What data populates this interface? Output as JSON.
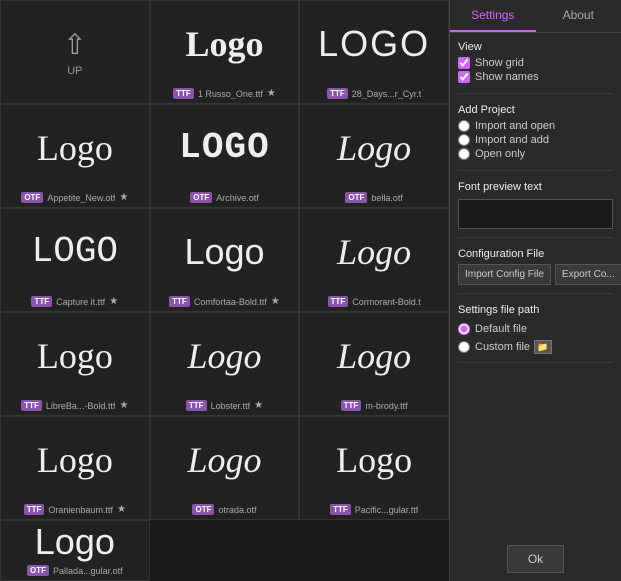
{
  "tabs": {
    "settings": "Settings",
    "about": "About"
  },
  "view": {
    "title": "View",
    "show_grid": "Show grid",
    "show_names": "Show names",
    "show_grid_checked": true,
    "show_names_checked": true
  },
  "add_project": {
    "title": "Add Project",
    "import_and_open": "Import and open",
    "import_and_add": "Import and add",
    "open_only": "Open only"
  },
  "font_preview": {
    "title": "Font preview text",
    "placeholder": ""
  },
  "config_file": {
    "title": "Configuration File",
    "import_btn": "Import Config File",
    "export_btn": "Export Co..."
  },
  "settings_file_path": {
    "title": "Settings file path",
    "default_file": "Default file",
    "custom_file": "Custom file"
  },
  "ok_btn": "Ok",
  "fonts": [
    {
      "name": "UP",
      "type": "up",
      "preview": "↑"
    },
    {
      "name": "1 Russo_One.ttf",
      "type": "TTF",
      "preview": "Logo",
      "starred": true,
      "style": "font-russo"
    },
    {
      "name": "28_Days...r_Cyr.t",
      "type": "TTF",
      "preview": "LOGO",
      "starred": false,
      "style": "font-28days"
    },
    {
      "name": "Appetite_New.otf",
      "type": "OTF",
      "preview": "Logo",
      "starred": true,
      "style": "font-appetite"
    },
    {
      "name": "Archive.otf",
      "type": "OTF",
      "preview": "LOGO",
      "starred": false,
      "style": "font-archive"
    },
    {
      "name": "bella.otf",
      "type": "OTF",
      "preview": "Logo",
      "starred": false,
      "style": "font-bella"
    },
    {
      "name": "Capture it.ttf",
      "type": "TTF",
      "preview": "LOGO",
      "starred": true,
      "style": "font-capture"
    },
    {
      "name": "Comfortaa-Bold.ttf",
      "type": "TTF",
      "preview": "Logo",
      "starred": true,
      "style": "font-comfortaa"
    },
    {
      "name": "Cormorant-Bold.t",
      "type": "TTF",
      "preview": "Logo",
      "starred": false,
      "style": "font-cormorant"
    },
    {
      "name": "LibreBa...-Bold.ttf",
      "type": "TTF",
      "preview": "Logo",
      "starred": true,
      "style": "font-librebask"
    },
    {
      "name": "Lobster.ttf",
      "type": "TTF",
      "preview": "Logo",
      "starred": true,
      "style": "font-lobster"
    },
    {
      "name": "m-brody.ttf",
      "type": "TTF",
      "preview": "Logo",
      "starred": false,
      "style": "font-mbrody"
    },
    {
      "name": "Oranienbaum.ttf",
      "type": "TTF",
      "preview": "Logo",
      "starred": true,
      "style": "font-oranien"
    },
    {
      "name": "otrada.otf",
      "type": "OTF",
      "preview": "Logo",
      "starred": false,
      "style": "font-otrada"
    },
    {
      "name": "Pacific...gular.ttf",
      "type": "TTF",
      "preview": "Logo",
      "starred": false,
      "style": "font-pacific"
    },
    {
      "name": "Pallada...gular.otf",
      "type": "OTF",
      "preview": "Logo",
      "starred": false,
      "style": "font-pallada"
    }
  ]
}
